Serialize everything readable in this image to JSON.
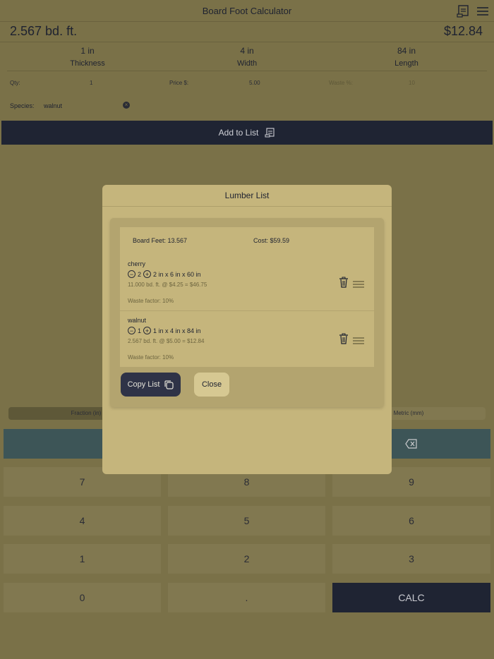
{
  "header": {
    "title": "Board Foot Calculator"
  },
  "summary": {
    "board_feet": "2.567 bd. ft.",
    "cost": "$12.84"
  },
  "dimensions": [
    {
      "value": "1 in",
      "label": "Thickness"
    },
    {
      "value": "4 in",
      "label": "Width"
    },
    {
      "value": "84 in",
      "label": "Length"
    }
  ],
  "options": {
    "qty_label": "Qty:",
    "qty_value": "1",
    "price_label": "Price $:",
    "price_value": "5.00",
    "waste_label": "Waste %:",
    "waste_value": "10"
  },
  "species": {
    "label": "Species:",
    "value": "walnut"
  },
  "add_button": {
    "label": "Add to List"
  },
  "units": {
    "fraction": "Fraction (in)",
    "metric": "Metric (mm)"
  },
  "keypad": {
    "keys": [
      "7",
      "8",
      "9",
      "4",
      "5",
      "6",
      "1",
      "2",
      "3",
      "0",
      "."
    ],
    "calc": "CALC"
  },
  "modal": {
    "title": "Lumber List",
    "total_board_feet": "Board Feet: 13.567",
    "total_cost": "Cost: $59.59",
    "items": [
      {
        "species": "cherry",
        "qty": "2",
        "dims": "2 in x 6 in x 60 in",
        "calc": "11.000 bd. ft. @ $4.25 = $46.75",
        "waste": "Waste factor: 10%"
      },
      {
        "species": "walnut",
        "qty": "1",
        "dims": "1 in x 4 in x 84 in",
        "calc": "2.567 bd. ft. @ $5.00 = $12.84",
        "waste": "Waste factor: 10%"
      }
    ],
    "copy_label": "Copy List",
    "close_label": "Close"
  },
  "colors": {
    "background": "#7a7148",
    "modal": "#c5b57c",
    "dark_button": "#1f2433",
    "teal": "#3d5557"
  }
}
